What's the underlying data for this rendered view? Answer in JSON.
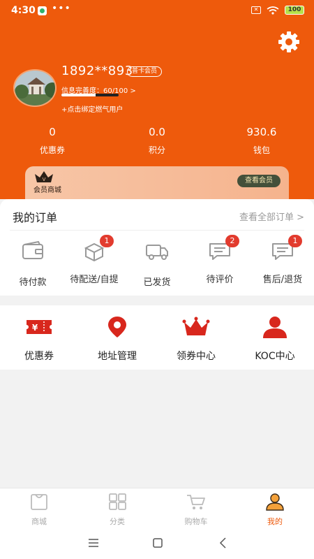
{
  "status_bar": {
    "time": "4:30",
    "dots": "•••",
    "sim": "✕",
    "battery": "100"
  },
  "profile": {
    "username": "1892**893",
    "member_level": "普卡会员",
    "completion_text": "信息完善度：60/100 >",
    "completion_progress": 0.6,
    "bind_gas_user": "+点击绑定燃气用户"
  },
  "stats": [
    {
      "value": "0",
      "label": "优惠券"
    },
    {
      "value": "0.0",
      "label": "积分"
    },
    {
      "value": "930.6",
      "label": "钱包"
    }
  ],
  "vip_card": {
    "title": "会员商城",
    "button": "查看会员"
  },
  "orders": {
    "title": "我的订单",
    "view_all": "查看全部订单 >",
    "items": [
      {
        "label": "待付款",
        "badge": ""
      },
      {
        "label": "待配送/自提",
        "badge": "1"
      },
      {
        "label": "已发货",
        "badge": ""
      },
      {
        "label": "待评价",
        "badge": "2"
      },
      {
        "label": "售后/退货",
        "badge": "1"
      }
    ]
  },
  "services": [
    {
      "label": "优惠券",
      "icon": "coupon-ticket-icon"
    },
    {
      "label": "地址管理",
      "icon": "location-pin-icon"
    },
    {
      "label": "领券中心",
      "icon": "crown-icon"
    },
    {
      "label": "KOC中心",
      "icon": "user-icon"
    }
  ],
  "tabbar": [
    {
      "label": "商城",
      "active": false
    },
    {
      "label": "分类",
      "active": false
    },
    {
      "label": "购物车",
      "active": false
    },
    {
      "label": "我的",
      "active": true
    }
  ],
  "colors": {
    "brand": "#ee5a0c",
    "accent_red": "#d8271d",
    "badge": "#e23b2e"
  }
}
